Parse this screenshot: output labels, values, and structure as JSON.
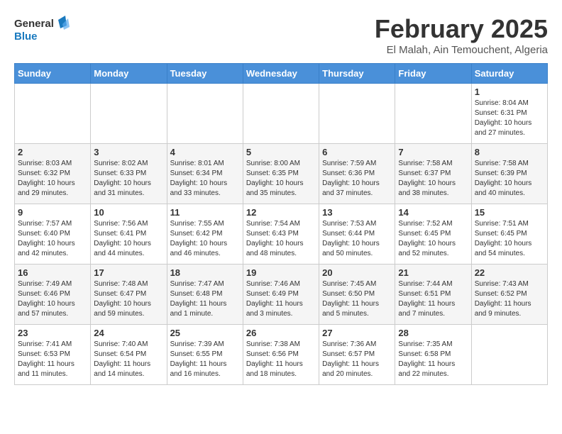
{
  "logo": {
    "line1": "General",
    "line2": "Blue"
  },
  "title": "February 2025",
  "subtitle": "El Malah, Ain Temouchent, Algeria",
  "weekdays": [
    "Sunday",
    "Monday",
    "Tuesday",
    "Wednesday",
    "Thursday",
    "Friday",
    "Saturday"
  ],
  "weeks": [
    [
      {
        "day": "",
        "info": ""
      },
      {
        "day": "",
        "info": ""
      },
      {
        "day": "",
        "info": ""
      },
      {
        "day": "",
        "info": ""
      },
      {
        "day": "",
        "info": ""
      },
      {
        "day": "",
        "info": ""
      },
      {
        "day": "1",
        "info": "Sunrise: 8:04 AM\nSunset: 6:31 PM\nDaylight: 10 hours and 27 minutes."
      }
    ],
    [
      {
        "day": "2",
        "info": "Sunrise: 8:03 AM\nSunset: 6:32 PM\nDaylight: 10 hours and 29 minutes."
      },
      {
        "day": "3",
        "info": "Sunrise: 8:02 AM\nSunset: 6:33 PM\nDaylight: 10 hours and 31 minutes."
      },
      {
        "day": "4",
        "info": "Sunrise: 8:01 AM\nSunset: 6:34 PM\nDaylight: 10 hours and 33 minutes."
      },
      {
        "day": "5",
        "info": "Sunrise: 8:00 AM\nSunset: 6:35 PM\nDaylight: 10 hours and 35 minutes."
      },
      {
        "day": "6",
        "info": "Sunrise: 7:59 AM\nSunset: 6:36 PM\nDaylight: 10 hours and 37 minutes."
      },
      {
        "day": "7",
        "info": "Sunrise: 7:58 AM\nSunset: 6:37 PM\nDaylight: 10 hours and 38 minutes."
      },
      {
        "day": "8",
        "info": "Sunrise: 7:58 AM\nSunset: 6:39 PM\nDaylight: 10 hours and 40 minutes."
      }
    ],
    [
      {
        "day": "9",
        "info": "Sunrise: 7:57 AM\nSunset: 6:40 PM\nDaylight: 10 hours and 42 minutes."
      },
      {
        "day": "10",
        "info": "Sunrise: 7:56 AM\nSunset: 6:41 PM\nDaylight: 10 hours and 44 minutes."
      },
      {
        "day": "11",
        "info": "Sunrise: 7:55 AM\nSunset: 6:42 PM\nDaylight: 10 hours and 46 minutes."
      },
      {
        "day": "12",
        "info": "Sunrise: 7:54 AM\nSunset: 6:43 PM\nDaylight: 10 hours and 48 minutes."
      },
      {
        "day": "13",
        "info": "Sunrise: 7:53 AM\nSunset: 6:44 PM\nDaylight: 10 hours and 50 minutes."
      },
      {
        "day": "14",
        "info": "Sunrise: 7:52 AM\nSunset: 6:45 PM\nDaylight: 10 hours and 52 minutes."
      },
      {
        "day": "15",
        "info": "Sunrise: 7:51 AM\nSunset: 6:45 PM\nDaylight: 10 hours and 54 minutes."
      }
    ],
    [
      {
        "day": "16",
        "info": "Sunrise: 7:49 AM\nSunset: 6:46 PM\nDaylight: 10 hours and 57 minutes."
      },
      {
        "day": "17",
        "info": "Sunrise: 7:48 AM\nSunset: 6:47 PM\nDaylight: 10 hours and 59 minutes."
      },
      {
        "day": "18",
        "info": "Sunrise: 7:47 AM\nSunset: 6:48 PM\nDaylight: 11 hours and 1 minute."
      },
      {
        "day": "19",
        "info": "Sunrise: 7:46 AM\nSunset: 6:49 PM\nDaylight: 11 hours and 3 minutes."
      },
      {
        "day": "20",
        "info": "Sunrise: 7:45 AM\nSunset: 6:50 PM\nDaylight: 11 hours and 5 minutes."
      },
      {
        "day": "21",
        "info": "Sunrise: 7:44 AM\nSunset: 6:51 PM\nDaylight: 11 hours and 7 minutes."
      },
      {
        "day": "22",
        "info": "Sunrise: 7:43 AM\nSunset: 6:52 PM\nDaylight: 11 hours and 9 minutes."
      }
    ],
    [
      {
        "day": "23",
        "info": "Sunrise: 7:41 AM\nSunset: 6:53 PM\nDaylight: 11 hours and 11 minutes."
      },
      {
        "day": "24",
        "info": "Sunrise: 7:40 AM\nSunset: 6:54 PM\nDaylight: 11 hours and 14 minutes."
      },
      {
        "day": "25",
        "info": "Sunrise: 7:39 AM\nSunset: 6:55 PM\nDaylight: 11 hours and 16 minutes."
      },
      {
        "day": "26",
        "info": "Sunrise: 7:38 AM\nSunset: 6:56 PM\nDaylight: 11 hours and 18 minutes."
      },
      {
        "day": "27",
        "info": "Sunrise: 7:36 AM\nSunset: 6:57 PM\nDaylight: 11 hours and 20 minutes."
      },
      {
        "day": "28",
        "info": "Sunrise: 7:35 AM\nSunset: 6:58 PM\nDaylight: 11 hours and 22 minutes."
      },
      {
        "day": "",
        "info": ""
      }
    ]
  ]
}
